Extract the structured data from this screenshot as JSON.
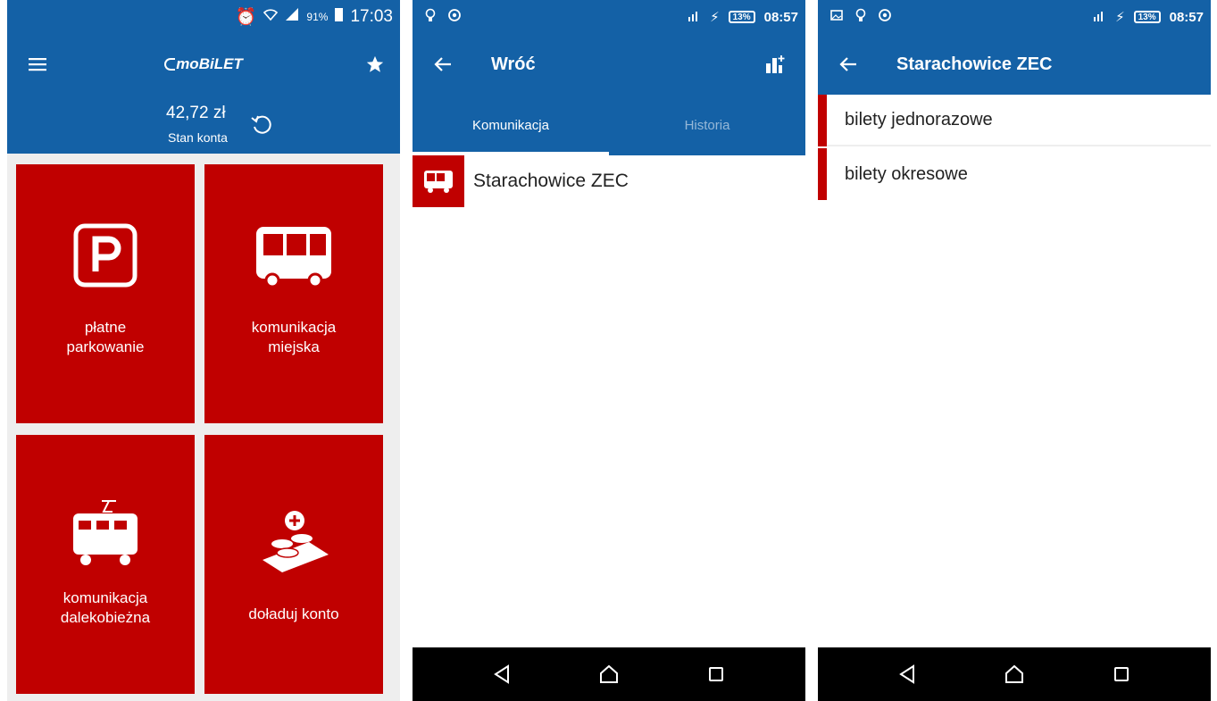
{
  "screen1": {
    "status": {
      "battery_pct": "91%",
      "time": "17:03"
    },
    "app_logo": "moBiLET",
    "balance": {
      "amount": "42,72 zł",
      "label": "Stan konta"
    },
    "tiles": [
      {
        "label": "płatne\nparkowanie",
        "icon": "parking-icon"
      },
      {
        "label": "komunikacja\nmiejska",
        "icon": "bus-icon"
      },
      {
        "label": "komunikacja\ndalekobieżna",
        "icon": "train-icon"
      },
      {
        "label": "doładuj konto",
        "icon": "coins-plus-icon"
      }
    ]
  },
  "screen2": {
    "status": {
      "battery_pct": "13%",
      "time": "08:57"
    },
    "back_label": "Wróć",
    "tabs": [
      {
        "label": "Komunikacja",
        "active": true
      },
      {
        "label": "Historia",
        "active": false
      }
    ],
    "operator": "Starachowice ZEC"
  },
  "screen3": {
    "status": {
      "battery_pct": "13%",
      "time": "08:57"
    },
    "title": "Starachowice ZEC",
    "rows": [
      "bilety jednorazowe",
      "bilety okresowe"
    ]
  },
  "colors": {
    "brand_blue": "#1461a6",
    "tile_red": "#c00000",
    "nav_black": "#000000"
  }
}
